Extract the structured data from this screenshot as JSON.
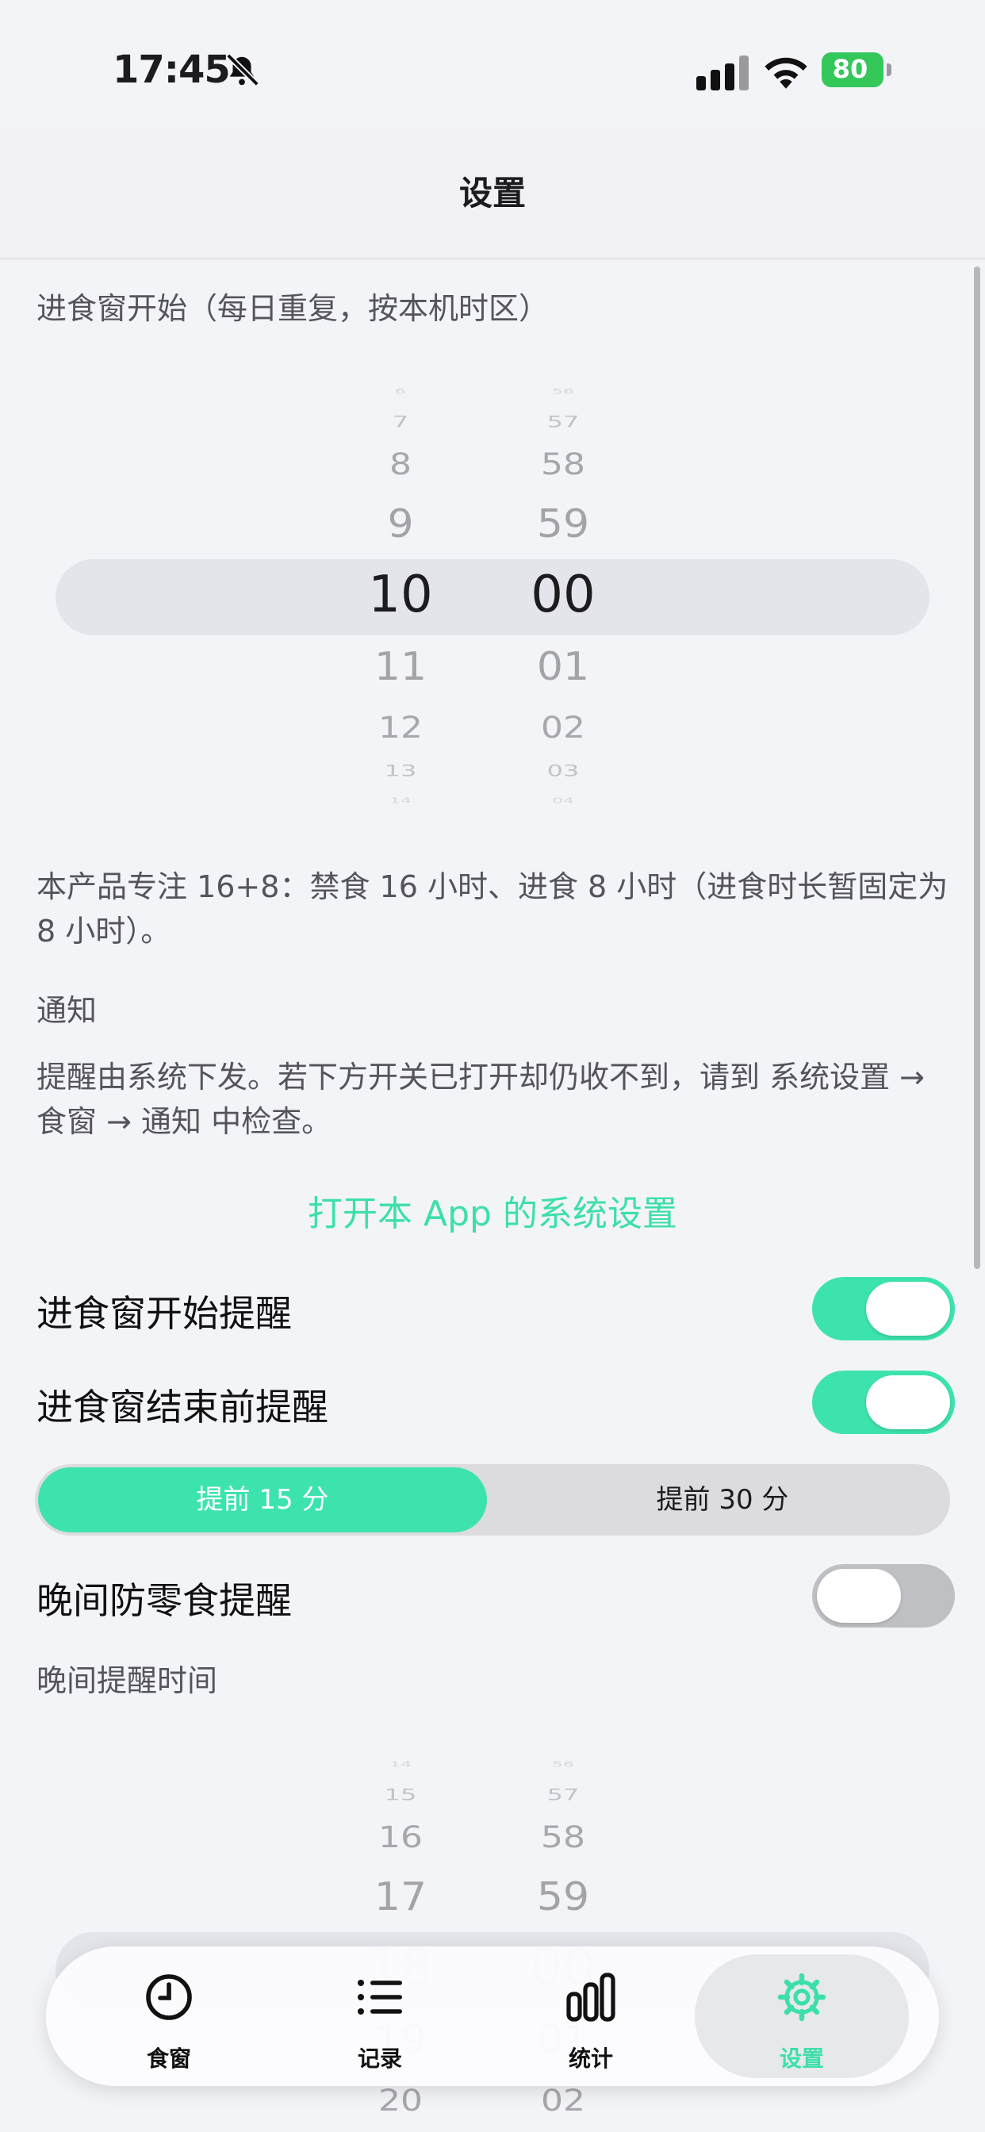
{
  "status_bar": {
    "time": "17:45",
    "battery": "80"
  },
  "nav": {
    "title": "设置"
  },
  "window_start": {
    "label": "进食窗开始（每日重复，按本机时区）",
    "hours": [
      "6",
      "7",
      "8",
      "9",
      "10",
      "11",
      "12",
      "13",
      "14"
    ],
    "minutes": [
      "56",
      "57",
      "58",
      "59",
      "00",
      "01",
      "02",
      "03",
      "04"
    ],
    "selected_hour": "10",
    "selected_minute": "00"
  },
  "note": "本产品专注 16+8：禁食 16 小时、进食 8 小时（进食时长暂固定为 8 小时）。",
  "notifications": {
    "header": "通知",
    "description": "提醒由系统下发。若下方开关已打开却仍收不到，请到 系统设置 → 食窗 → 通知 中检查。",
    "open_settings_link": "打开本 App 的系统设置"
  },
  "reminders": {
    "start": {
      "label": "进食窗开始提醒",
      "on": true
    },
    "end": {
      "label": "进食窗结束前提醒",
      "on": true
    },
    "lead_options": [
      "提前 15 分",
      "提前 30 分"
    ],
    "lead_selected": "提前 15 分",
    "evening": {
      "label": "晚间防零食提醒",
      "on": false
    },
    "evening_time_label": "晚间提醒时间"
  },
  "evening_picker": {
    "hours": [
      "14",
      "15",
      "16",
      "17",
      "18",
      "19",
      "20"
    ],
    "minutes": [
      "56",
      "57",
      "58",
      "59",
      "00",
      "01",
      "02"
    ],
    "selected_hour": "18",
    "selected_minute": "00"
  },
  "tabs": [
    {
      "label": "食窗",
      "icon": "clock-icon"
    },
    {
      "label": "记录",
      "icon": "list-icon"
    },
    {
      "label": "统计",
      "icon": "bar-chart-icon"
    },
    {
      "label": "设置",
      "icon": "gear-icon",
      "active": true
    }
  ],
  "colors": {
    "accent": "#3de3ad",
    "background": "#f3f4f8",
    "toggle_off": "#bfc0c4"
  }
}
